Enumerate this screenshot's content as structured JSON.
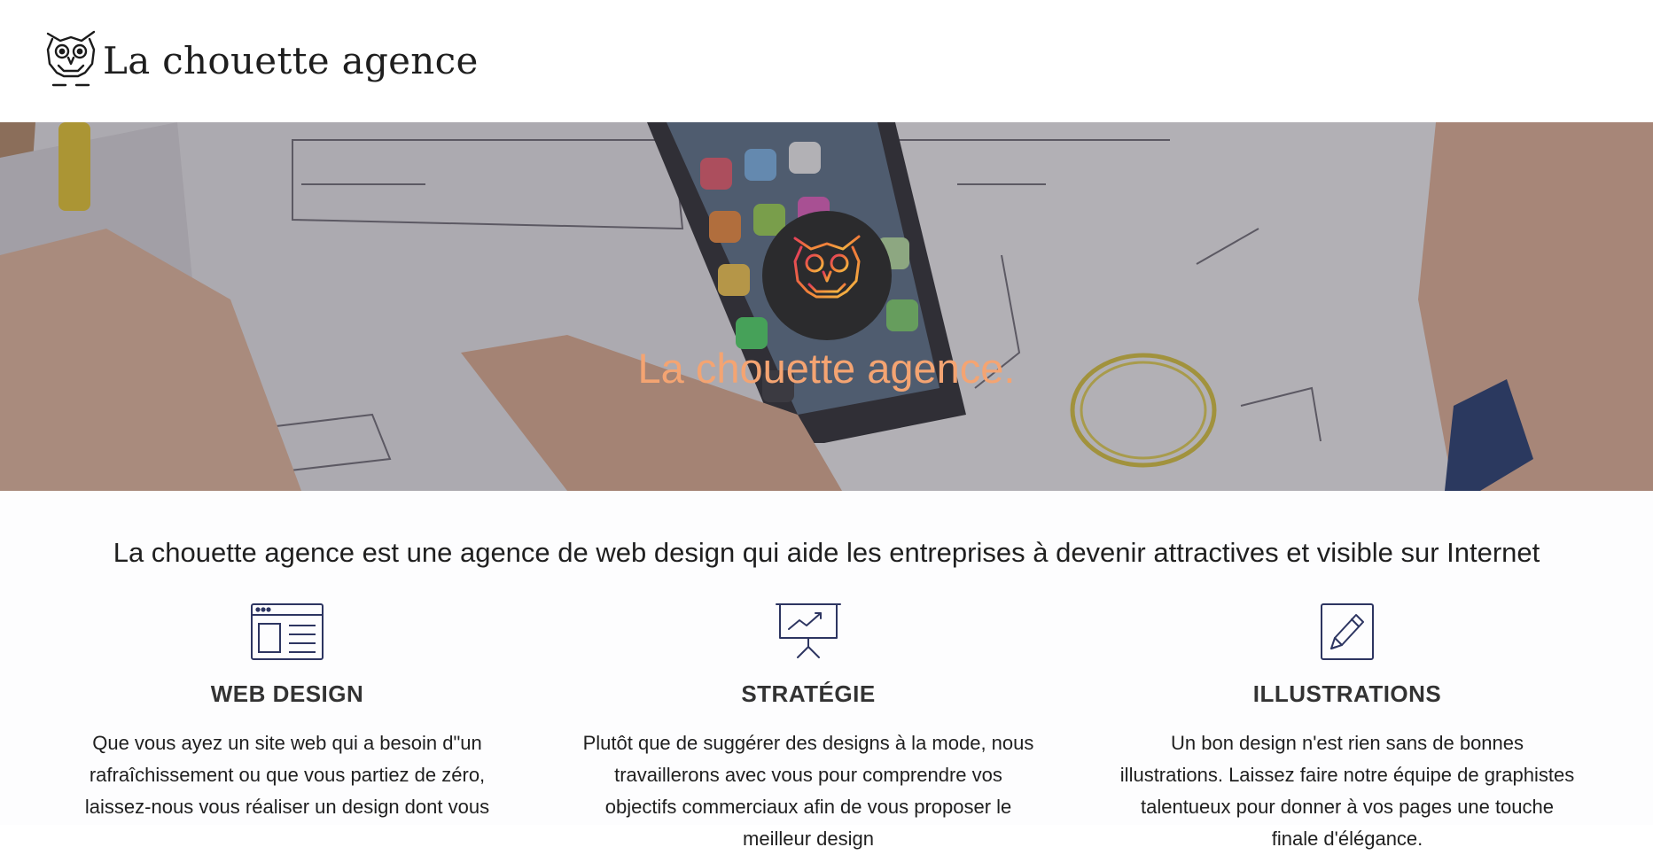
{
  "header": {
    "logo_text": "La chouette agence"
  },
  "hero": {
    "title": "La chouette agence."
  },
  "intro": {
    "text": "La chouette agence est une agence de web design qui aide les entreprises à devenir attractives et visible sur Internet"
  },
  "services": [
    {
      "icon": "web-design-icon",
      "title": "WEB DESIGN",
      "description": "Que vous ayez un site web qui a besoin d\"un rafraîchissement ou que vous partiez de zéro, laissez-nous vous réaliser un design dont vous"
    },
    {
      "icon": "presentation-chart-icon",
      "title": "STRATÉGIE",
      "description": "Plutôt que de suggérer des designs à la mode, nous travaillerons avec vous pour comprendre vos objectifs commerciaux afin de vous proposer le meilleur design"
    },
    {
      "icon": "pencil-icon",
      "title": "ILLUSTRATIONS",
      "description": "Un bon design n'est rien sans de bonnes illustrations. Laissez faire notre équipe de graphistes talentueux pour donner à vos pages une touche finale d'élégance."
    }
  ],
  "colors": {
    "hero_title": "#f4a472",
    "icon_stroke": "#2d3561",
    "badge_bg": "#2b2b2d"
  }
}
